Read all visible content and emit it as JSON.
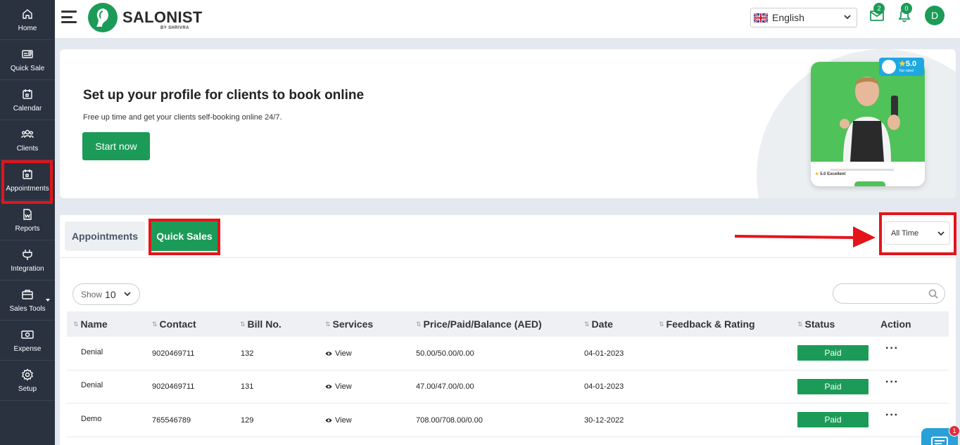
{
  "sidebar": {
    "items": [
      {
        "label": "Home",
        "icon": "home-icon"
      },
      {
        "label": "Quick Sale",
        "icon": "register-icon"
      },
      {
        "label": "Calendar",
        "icon": "calendar-icon"
      },
      {
        "label": "Clients",
        "icon": "users-icon"
      },
      {
        "label": "Appointments",
        "icon": "calendar-check-icon"
      },
      {
        "label": "Reports",
        "icon": "document-icon"
      },
      {
        "label": "Integration",
        "icon": "plug-icon"
      },
      {
        "label": "Sales Tools",
        "icon": "briefcase-icon"
      },
      {
        "label": "Expense",
        "icon": "money-icon"
      },
      {
        "label": "Setup",
        "icon": "gear-icon"
      }
    ]
  },
  "header": {
    "logo_text": "SALONIST",
    "logo_sub": "BY SHRIVRA",
    "language": "English",
    "mail_count": "2",
    "notif_count": "0",
    "avatar_initial": "D"
  },
  "banner": {
    "title": "Set up your profile for clients to book online",
    "subtitle": "Free up time and get your clients self-booking online 24/7.",
    "cta": "Start now",
    "rating_value": "5.0",
    "rating_caption": "Top rated",
    "rating_text": "5.0 Excellent"
  },
  "tabs": {
    "appointments": "Appointments",
    "quick_sales": "Quick Sales"
  },
  "filter": {
    "period": "All Time"
  },
  "table_controls": {
    "show_label": "Show",
    "show_value": "10"
  },
  "table": {
    "headers": [
      "Name",
      "Contact",
      "Bill No.",
      "Services",
      "Price/Paid/Balance (AED)",
      "Date",
      "Feedback & Rating",
      "Status",
      "Action"
    ],
    "rows": [
      {
        "name": "Denial",
        "contact": "9020469711",
        "bill": "132",
        "services": "View",
        "price": "50.00/50.00/0.00",
        "date": "04-01-2023",
        "feedback": "",
        "status": "Paid"
      },
      {
        "name": "Denial",
        "contact": "9020469711",
        "bill": "131",
        "services": "View",
        "price": "47.00/47.00/0.00",
        "date": "04-01-2023",
        "feedback": "",
        "status": "Paid"
      },
      {
        "name": "Demo",
        "contact": "765546789",
        "bill": "129",
        "services": "View",
        "price": "708.00/708.00/0.00",
        "date": "30-12-2022",
        "feedback": "",
        "status": "Paid"
      }
    ]
  },
  "chat": {
    "badge": "1"
  },
  "colors": {
    "sidebar_bg": "#2a3240",
    "brand_green": "#1c9b58",
    "highlight_red": "#e4141b",
    "page_bg": "#e4e9ef"
  }
}
